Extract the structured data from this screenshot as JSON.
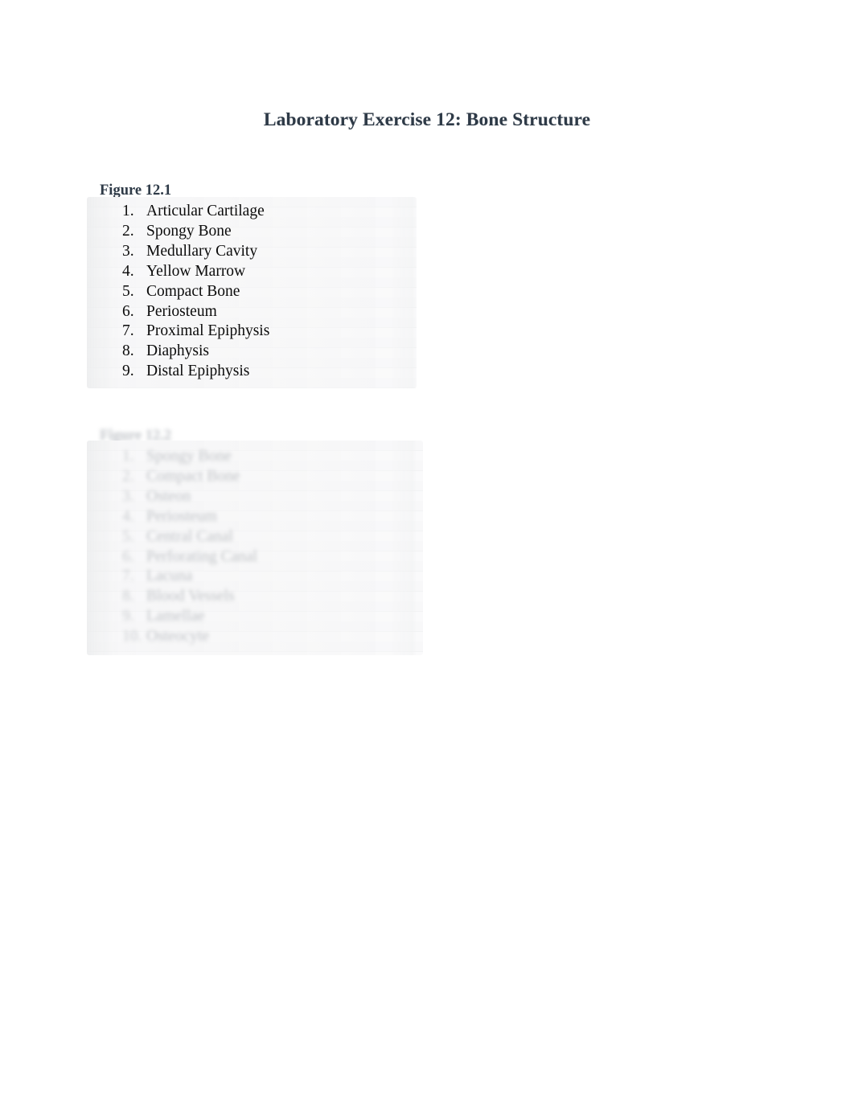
{
  "document": {
    "title": "Laboratory Exercise 12: Bone Structure"
  },
  "figure_1": {
    "heading": "Figure 12.1",
    "items": [
      {
        "num": "1.",
        "label": "Articular Cartilage"
      },
      {
        "num": "2.",
        "label": "Spongy Bone"
      },
      {
        "num": "3.",
        "label": "Medullary Cavity"
      },
      {
        "num": "4.",
        "label": "Yellow Marrow"
      },
      {
        "num": "5.",
        "label": "Compact Bone"
      },
      {
        "num": "6.",
        "label": "Periosteum"
      },
      {
        "num": "7.",
        "label": "Proximal Epiphysis"
      },
      {
        "num": "8.",
        "label": "Diaphysis"
      },
      {
        "num": "9.",
        "label": "Distal Epiphysis"
      }
    ]
  },
  "figure_2": {
    "heading": "Figure 12.2",
    "items": [
      {
        "num": "1.",
        "label": "Spongy Bone"
      },
      {
        "num": "2.",
        "label": "Compact Bone"
      },
      {
        "num": "3.",
        "label": "Osteon"
      },
      {
        "num": "4.",
        "label": "Periosteum"
      },
      {
        "num": "5.",
        "label": "Central Canal"
      },
      {
        "num": "6.",
        "label": "Perforating Canal"
      },
      {
        "num": "7.",
        "label": "Lacuna"
      },
      {
        "num": "8.",
        "label": "Blood Vessels"
      },
      {
        "num": "9.",
        "label": "Lamellae"
      },
      {
        "num": "10.",
        "label": "Osteocyte"
      }
    ]
  }
}
